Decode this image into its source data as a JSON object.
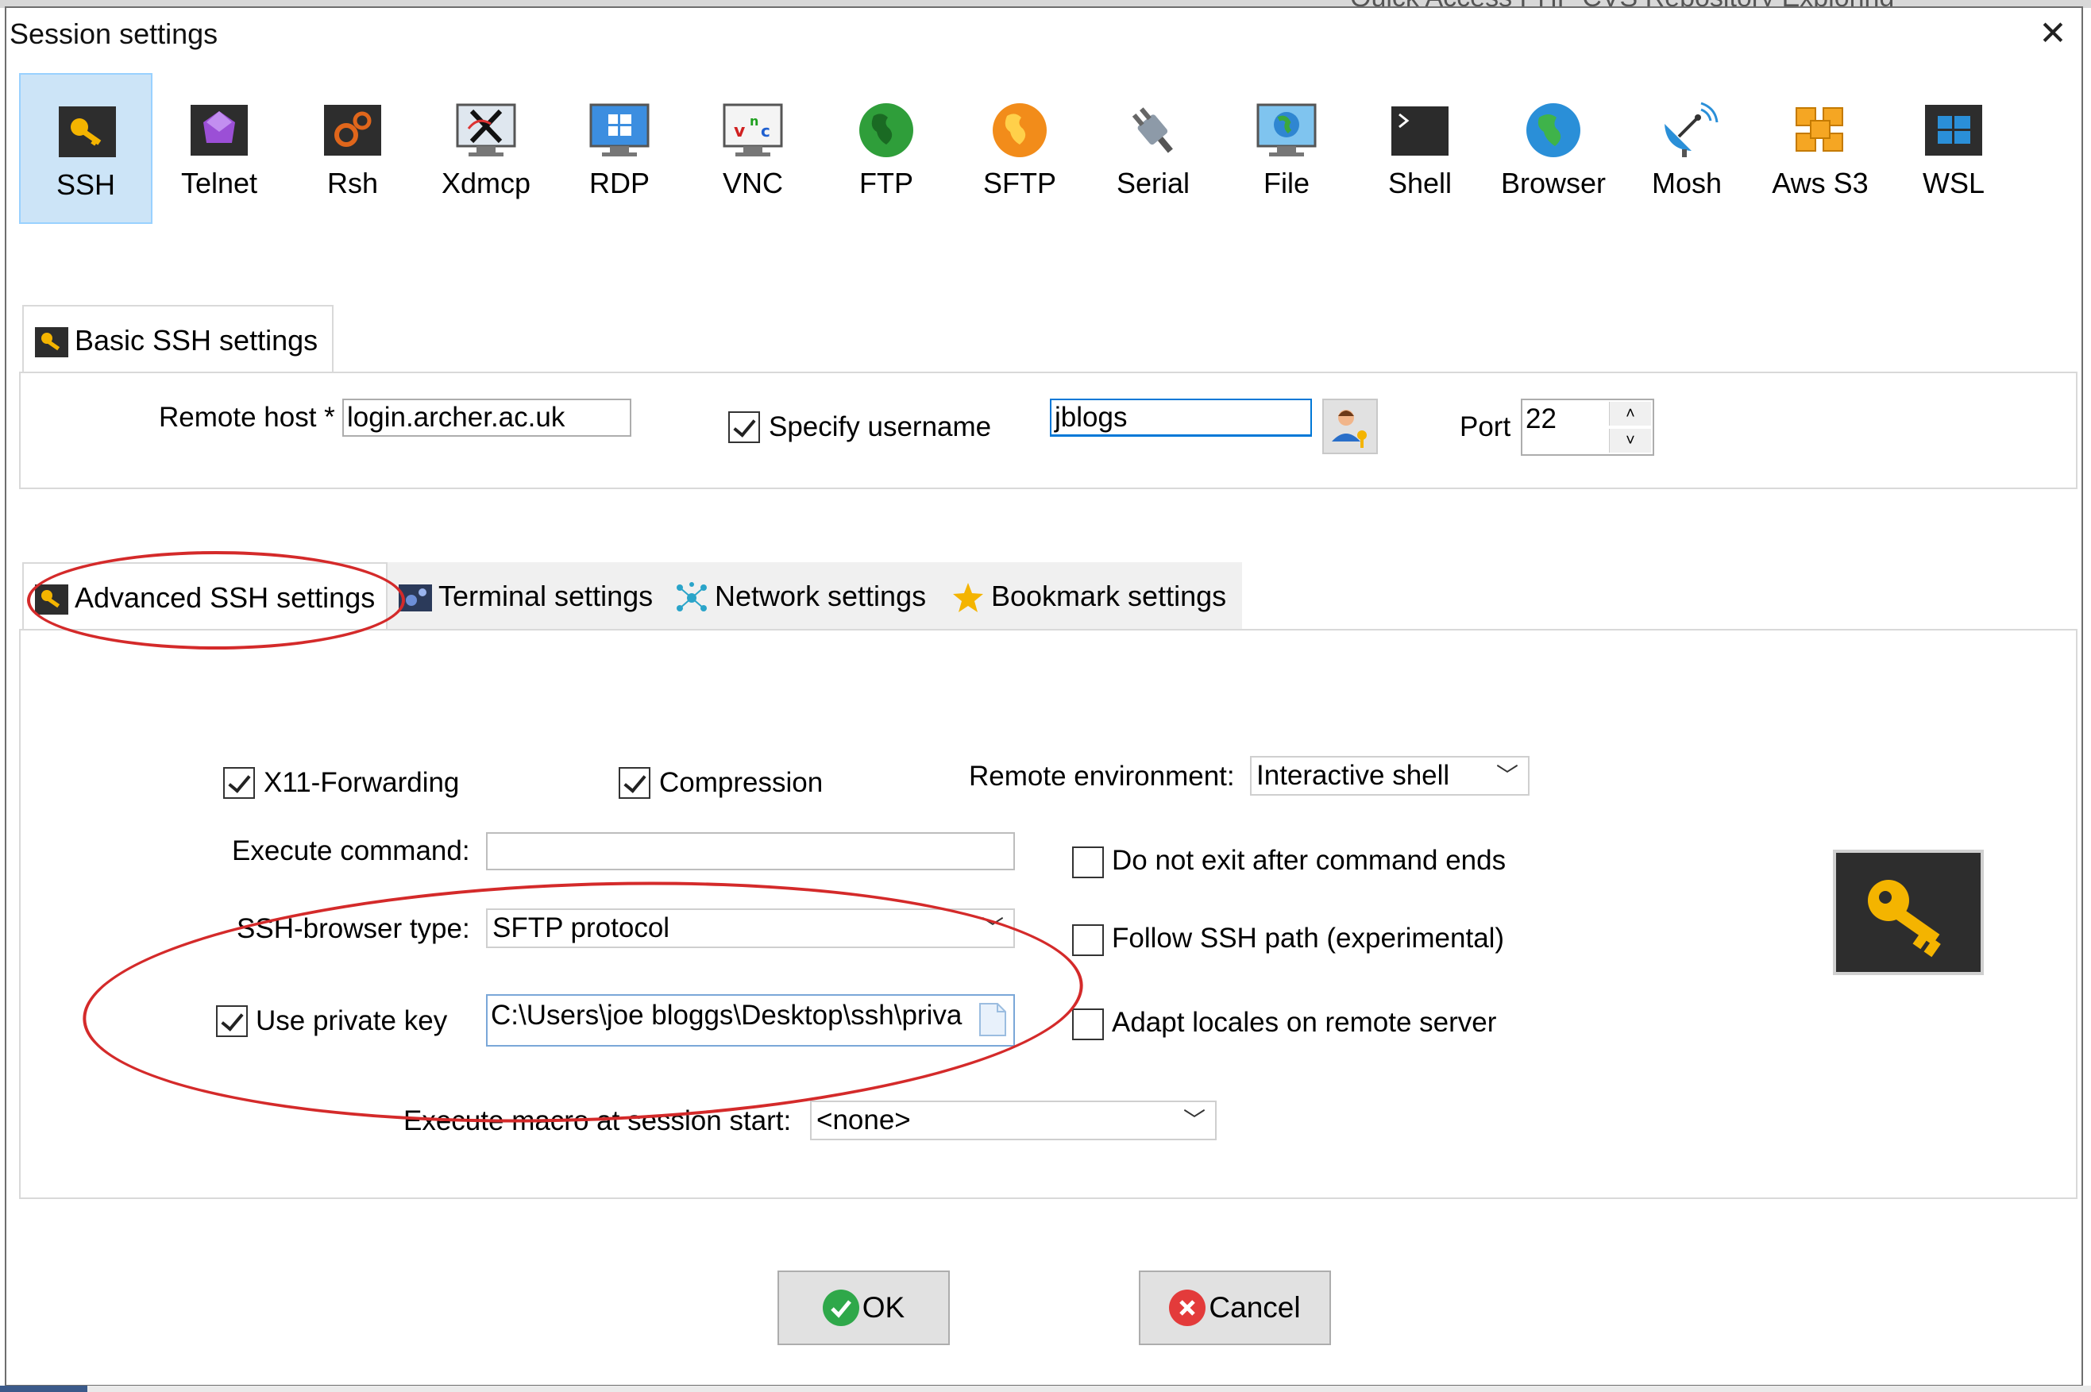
{
  "window": {
    "title": "Session settings",
    "close_label": "✕"
  },
  "background": {
    "behind_text": "Quick Access  PHP  CVS Repository Exploring"
  },
  "session_types": [
    {
      "label": "SSH",
      "icon": "key-icon"
    },
    {
      "label": "Telnet",
      "icon": "telnet-icon"
    },
    {
      "label": "Rsh",
      "icon": "rsh-icon"
    },
    {
      "label": "Xdmcp",
      "icon": "xdmcp-icon"
    },
    {
      "label": "RDP",
      "icon": "rdp-icon"
    },
    {
      "label": "VNC",
      "icon": "vnc-icon"
    },
    {
      "label": "FTP",
      "icon": "ftp-globe-icon"
    },
    {
      "label": "SFTP",
      "icon": "sftp-globe-icon"
    },
    {
      "label": "Serial",
      "icon": "serial-plug-icon"
    },
    {
      "label": "File",
      "icon": "file-monitor-icon"
    },
    {
      "label": "Shell",
      "icon": "shell-terminal-icon"
    },
    {
      "label": "Browser",
      "icon": "browser-globe-icon"
    },
    {
      "label": "Mosh",
      "icon": "satellite-dish-icon"
    },
    {
      "label": "Aws S3",
      "icon": "aws-cubes-icon"
    },
    {
      "label": "WSL",
      "icon": "windows-icon"
    }
  ],
  "basic": {
    "tab_label": "Basic SSH settings",
    "remote_host_label": "Remote host *",
    "remote_host_value": "login.archer.ac.uk",
    "specify_username_label": "Specify username",
    "specify_username_checked": true,
    "username_value": "jblogs",
    "port_label": "Port",
    "port_value": "22",
    "spin_up": "˄",
    "spin_down": "˅"
  },
  "tabs": [
    {
      "label": "Advanced SSH settings",
      "icon": "key-icon"
    },
    {
      "label": "Terminal settings",
      "icon": "terminal-gear-icon"
    },
    {
      "label": "Network settings",
      "icon": "network-icon"
    },
    {
      "label": "Bookmark settings",
      "icon": "star-icon"
    }
  ],
  "advanced": {
    "x11_label": "X11-Forwarding",
    "x11_checked": true,
    "compression_label": "Compression",
    "compression_checked": true,
    "remote_env_label": "Remote environment:",
    "remote_env_value": "Interactive shell",
    "exec_cmd_label": "Execute command:",
    "exec_cmd_value": "",
    "no_exit_label": "Do not exit after command ends",
    "no_exit_checked": false,
    "browser_type_label": "SSH-browser type:",
    "browser_type_value": "SFTP protocol",
    "follow_path_label": "Follow SSH path (experimental)",
    "follow_path_checked": false,
    "private_key_label": "Use private key",
    "private_key_checked": true,
    "private_key_value": "C:\\Users\\joe bloggs\\Desktop\\ssh\\priva",
    "adapt_locales_label": "Adapt locales on remote server",
    "adapt_locales_checked": false,
    "macro_label": "Execute macro at session start:",
    "macro_value": "<none>"
  },
  "buttons": {
    "ok": "OK",
    "cancel": "Cancel"
  },
  "colors": {
    "annotation": "#d42a2a",
    "selection": "#cce4f7",
    "key_tile": "#2d2d2d",
    "key": "#f4b400"
  }
}
